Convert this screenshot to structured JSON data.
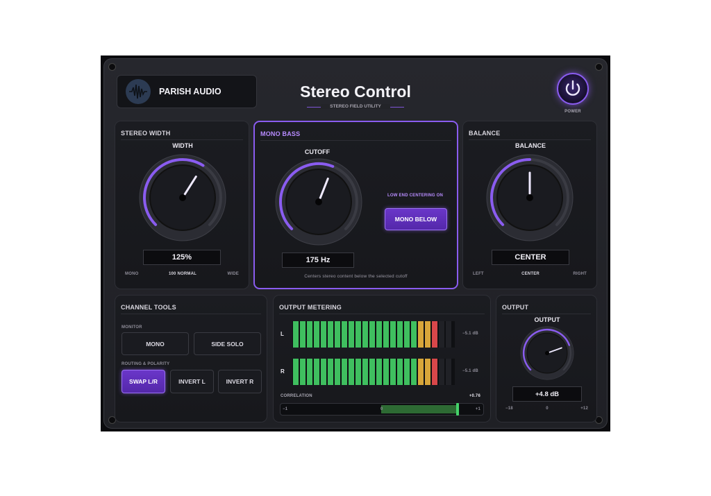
{
  "header": {
    "brand": "PARISH AUDIO",
    "title": "Stereo Control",
    "subtitle": "STEREO FIELD UTILITY",
    "power_label": "POWER"
  },
  "stereo_width": {
    "title": "STEREO WIDTH",
    "knob_label": "WIDTH",
    "value": "125%",
    "scale_left": "MONO",
    "scale_center": "100 NORMAL",
    "scale_right": "WIDE",
    "knob_fraction": 0.62
  },
  "mono_bass": {
    "title": "MONO BASS",
    "knob_label": "CUTOFF",
    "value": "175 Hz",
    "status": "LOW END CENTERING ON",
    "button": "MONO BELOW",
    "description": "Centers stereo content below the selected cutoff",
    "knob_fraction": 0.58
  },
  "balance": {
    "title": "BALANCE",
    "knob_label": "BALANCE",
    "value": "CENTER",
    "scale_left": "LEFT",
    "scale_center": "CENTER",
    "scale_right": "RIGHT",
    "knob_fraction": 0.5
  },
  "channel_tools": {
    "title": "CHANNEL TOOLS",
    "monitor_label": "MONITOR",
    "mono_button": "MONO",
    "side_solo_button": "SIDE SOLO",
    "routing_label": "ROUTING & POLARITY",
    "swap_button": "SWAP L/R",
    "invert_l_button": "INVERT L",
    "invert_r_button": "INVERT R"
  },
  "metering": {
    "title": "OUTPUT METERING",
    "left_label": "L",
    "right_label": "R",
    "left_value": "−5.1 dB",
    "right_value": "−5.1 dB",
    "lit_segments": 21,
    "total_segments": 23,
    "correlation_label": "CORRELATION",
    "correlation_value": "+0.76",
    "correlation_min": "−1",
    "correlation_mid": "0",
    "correlation_max": "+1",
    "correlation": 0.76
  },
  "output": {
    "title": "OUTPUT",
    "knob_label": "OUTPUT",
    "value": "+4.8 dB",
    "scale_left": "−18",
    "scale_center": "0",
    "scale_right": "+12",
    "knob_fraction": 0.76
  },
  "colors": {
    "accent": "#8a5cf0",
    "meter_green": "#3fbf5f",
    "meter_yellow": "#d8a63a",
    "meter_red": "#d9474a"
  }
}
